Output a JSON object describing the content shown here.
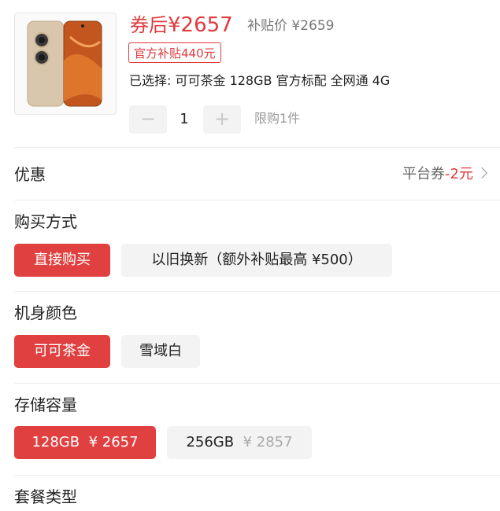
{
  "header": {
    "after_coupon_label": "券后",
    "after_coupon_price": "¥2657",
    "subsidy_price": "补贴价 ¥2659",
    "official_subsidy_badge": "官方补贴440元",
    "selected_summary": "已选择: 可可茶金 128GB 官方标配 全网通 4G",
    "quantity": "1",
    "minus_label": "−",
    "plus_label": "+",
    "limit_text": "限购1件"
  },
  "promo": {
    "title": "优惠",
    "coupon_label": "平台券",
    "coupon_value": "-2元"
  },
  "purchase_method": {
    "title": "购买方式",
    "options": [
      {
        "label": "直接购买",
        "selected": true
      },
      {
        "label": "以旧换新（额外补贴最高 ¥500）",
        "selected": false
      }
    ]
  },
  "color": {
    "title": "机身颜色",
    "options": [
      {
        "label": "可可茶金",
        "selected": true
      },
      {
        "label": "雪域白",
        "selected": false
      }
    ]
  },
  "storage": {
    "title": "存储容量",
    "options": [
      {
        "label": "128GB",
        "price": "¥ 2657",
        "selected": true
      },
      {
        "label": "256GB",
        "price": "¥ 2857",
        "selected": false
      }
    ]
  },
  "package": {
    "title": "套餐类型"
  },
  "colors": {
    "accent": "#e0393e",
    "chip_inactive_bg": "#f3f3f3"
  }
}
